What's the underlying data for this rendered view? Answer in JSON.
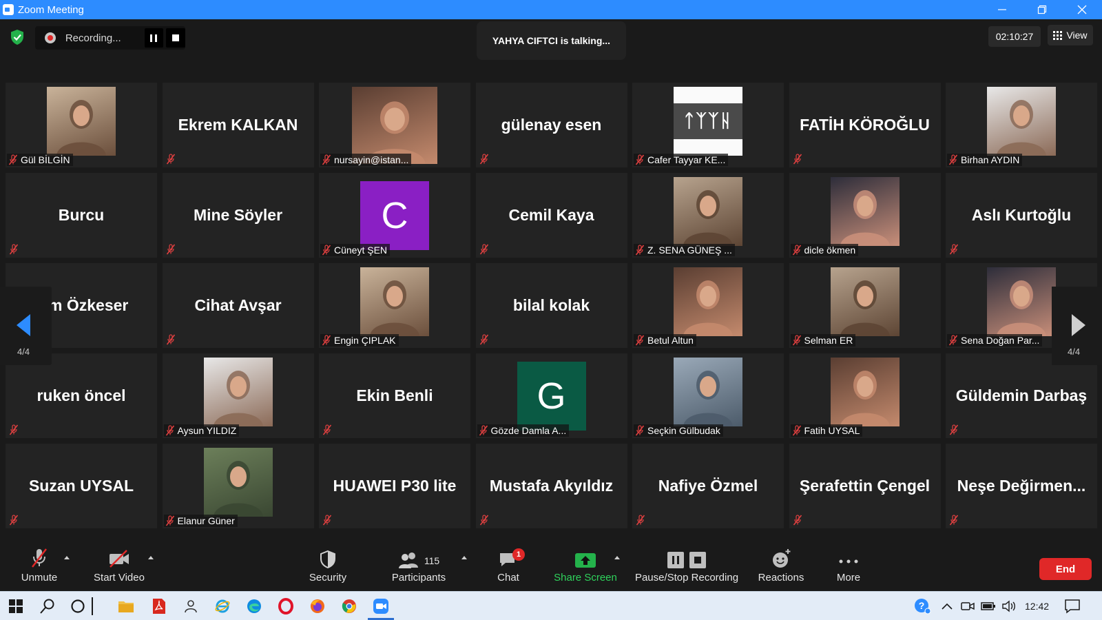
{
  "window": {
    "title": "Zoom Meeting",
    "colors": {
      "titlebar": "#2d8cff",
      "background": "#1a1a1a",
      "tile": "#232323",
      "end": "#e02828",
      "share": "#2fd35c"
    }
  },
  "top": {
    "recording_label": "Recording...",
    "talking_label": "YAHYA CIFTCI is talking...",
    "timer": "02:10:27",
    "view_label": "View"
  },
  "pager": {
    "prev_label": "4/4",
    "next_label": "4/4"
  },
  "participants": [
    {
      "name": "Gül BİLGİN",
      "kind": "photo"
    },
    {
      "name": "Ekrem  KALKAN",
      "kind": "text"
    },
    {
      "name": "nursayin@istan...",
      "kind": "photo"
    },
    {
      "name": "gülenay esen",
      "kind": "text"
    },
    {
      "name": "Cafer Tayyar KE...",
      "kind": "photo",
      "pic_text": "ᛏᛉᛉᚺ"
    },
    {
      "name": "FATİH KÖROĞLU",
      "kind": "text"
    },
    {
      "name": "Birhan AYDIN",
      "kind": "photo"
    },
    {
      "name": "Burcu",
      "kind": "text"
    },
    {
      "name": "Mine Söyler",
      "kind": "text"
    },
    {
      "name": "Cüneyt ŞEN",
      "kind": "avatar",
      "letter": "C",
      "color": "#8a1fc4"
    },
    {
      "name": "Cemil Kaya",
      "kind": "text"
    },
    {
      "name": "Z. SENA GÜNEŞ ...",
      "kind": "photo"
    },
    {
      "name": "dicle ökmen",
      "kind": "photo"
    },
    {
      "name": "Aslı Kurtoğlu",
      "kind": "text"
    },
    {
      "name": "him Özkeser",
      "kind": "text"
    },
    {
      "name": "Cihat Avşar",
      "kind": "text"
    },
    {
      "name": "Engin ÇIPLAK",
      "kind": "photo"
    },
    {
      "name": "bilal kolak",
      "kind": "text"
    },
    {
      "name": "Betul Altun",
      "kind": "photo"
    },
    {
      "name": "Selman ER",
      "kind": "photo"
    },
    {
      "name": "Sena Doğan Par...",
      "kind": "photo"
    },
    {
      "name": "ruken öncel",
      "kind": "text"
    },
    {
      "name": "Aysun YILDIZ",
      "kind": "photo"
    },
    {
      "name": "Ekin Benli",
      "kind": "text"
    },
    {
      "name": "Gözde Damla A...",
      "kind": "avatar",
      "letter": "G",
      "color": "#0a5a44"
    },
    {
      "name": "Seçkin Gülbudak",
      "kind": "photo"
    },
    {
      "name": "Fatih UYSAL",
      "kind": "photo"
    },
    {
      "name": "Güldemin Darbaş",
      "kind": "text"
    },
    {
      "name": "Suzan UYSAL",
      "kind": "text"
    },
    {
      "name": "Elanur Güner",
      "kind": "photo"
    },
    {
      "name": "HUAWEI P30 lite",
      "kind": "text"
    },
    {
      "name": "Mustafa Akyıldız",
      "kind": "text"
    },
    {
      "name": "Nafiye Özmel",
      "kind": "text"
    },
    {
      "name": "Şerafettin Çengel",
      "kind": "text"
    },
    {
      "name": "Neşe  Değirmen...",
      "kind": "text"
    }
  ],
  "toolbar": {
    "unmute": "Unmute",
    "start_video": "Start Video",
    "security": "Security",
    "participants": "Participants",
    "participants_count": "115",
    "chat": "Chat",
    "chat_badge": "1",
    "share_screen": "Share Screen",
    "pause_stop": "Pause/Stop Recording",
    "reactions": "Reactions",
    "more": "More",
    "end": "End"
  },
  "taskbar": {
    "time": "12:42"
  }
}
